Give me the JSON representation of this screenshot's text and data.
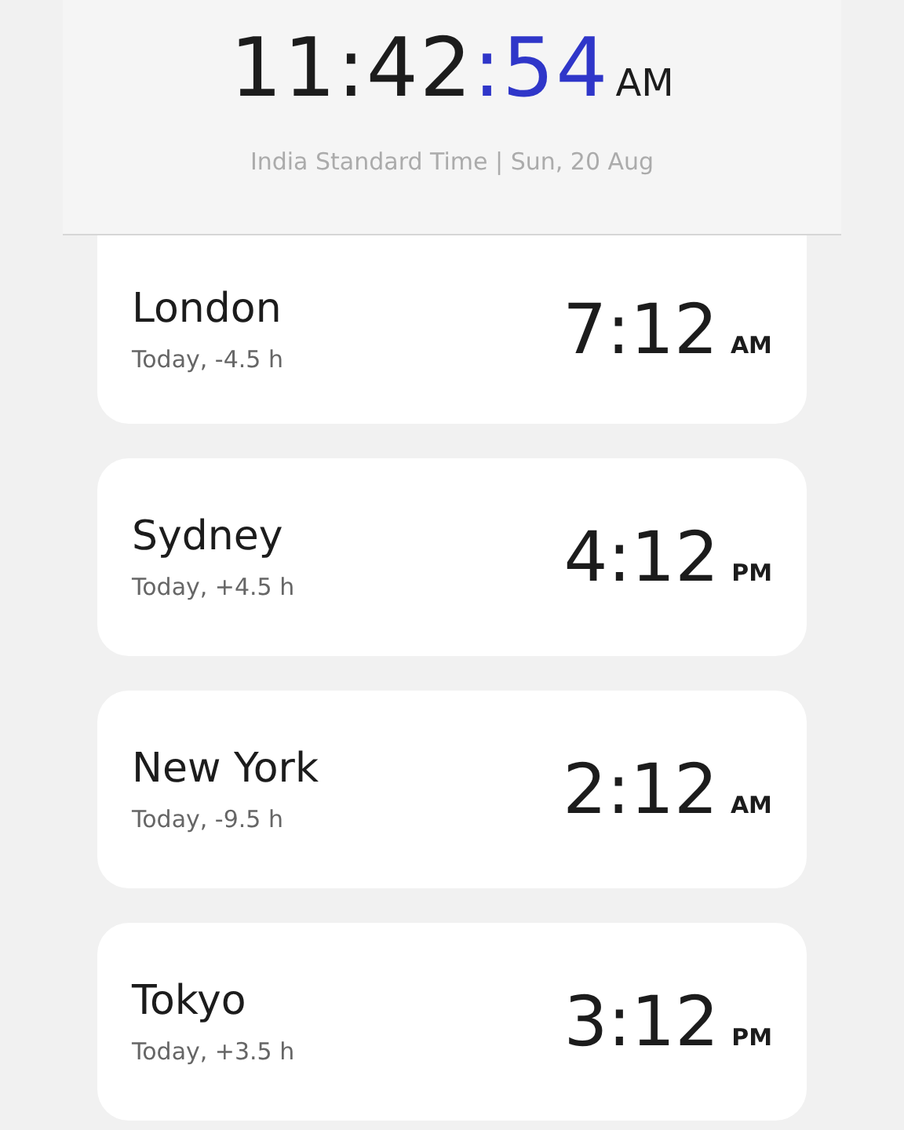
{
  "clock": {
    "hours_minutes": "11:42",
    "seconds": ":54",
    "period": "AM",
    "subtitle": "India Standard Time | Sun, 20 Aug"
  },
  "cities": [
    {
      "name": "London",
      "offset": "Today, -4.5 h",
      "time": "7:12",
      "period": "AM"
    },
    {
      "name": "Sydney",
      "offset": "Today, +4.5 h",
      "time": "4:12",
      "period": "PM"
    },
    {
      "name": "New York",
      "offset": "Today, -9.5 h",
      "time": "2:12",
      "period": "AM"
    },
    {
      "name": "Tokyo",
      "offset": "Today, +3.5 h",
      "time": "3:12",
      "period": "PM"
    }
  ]
}
